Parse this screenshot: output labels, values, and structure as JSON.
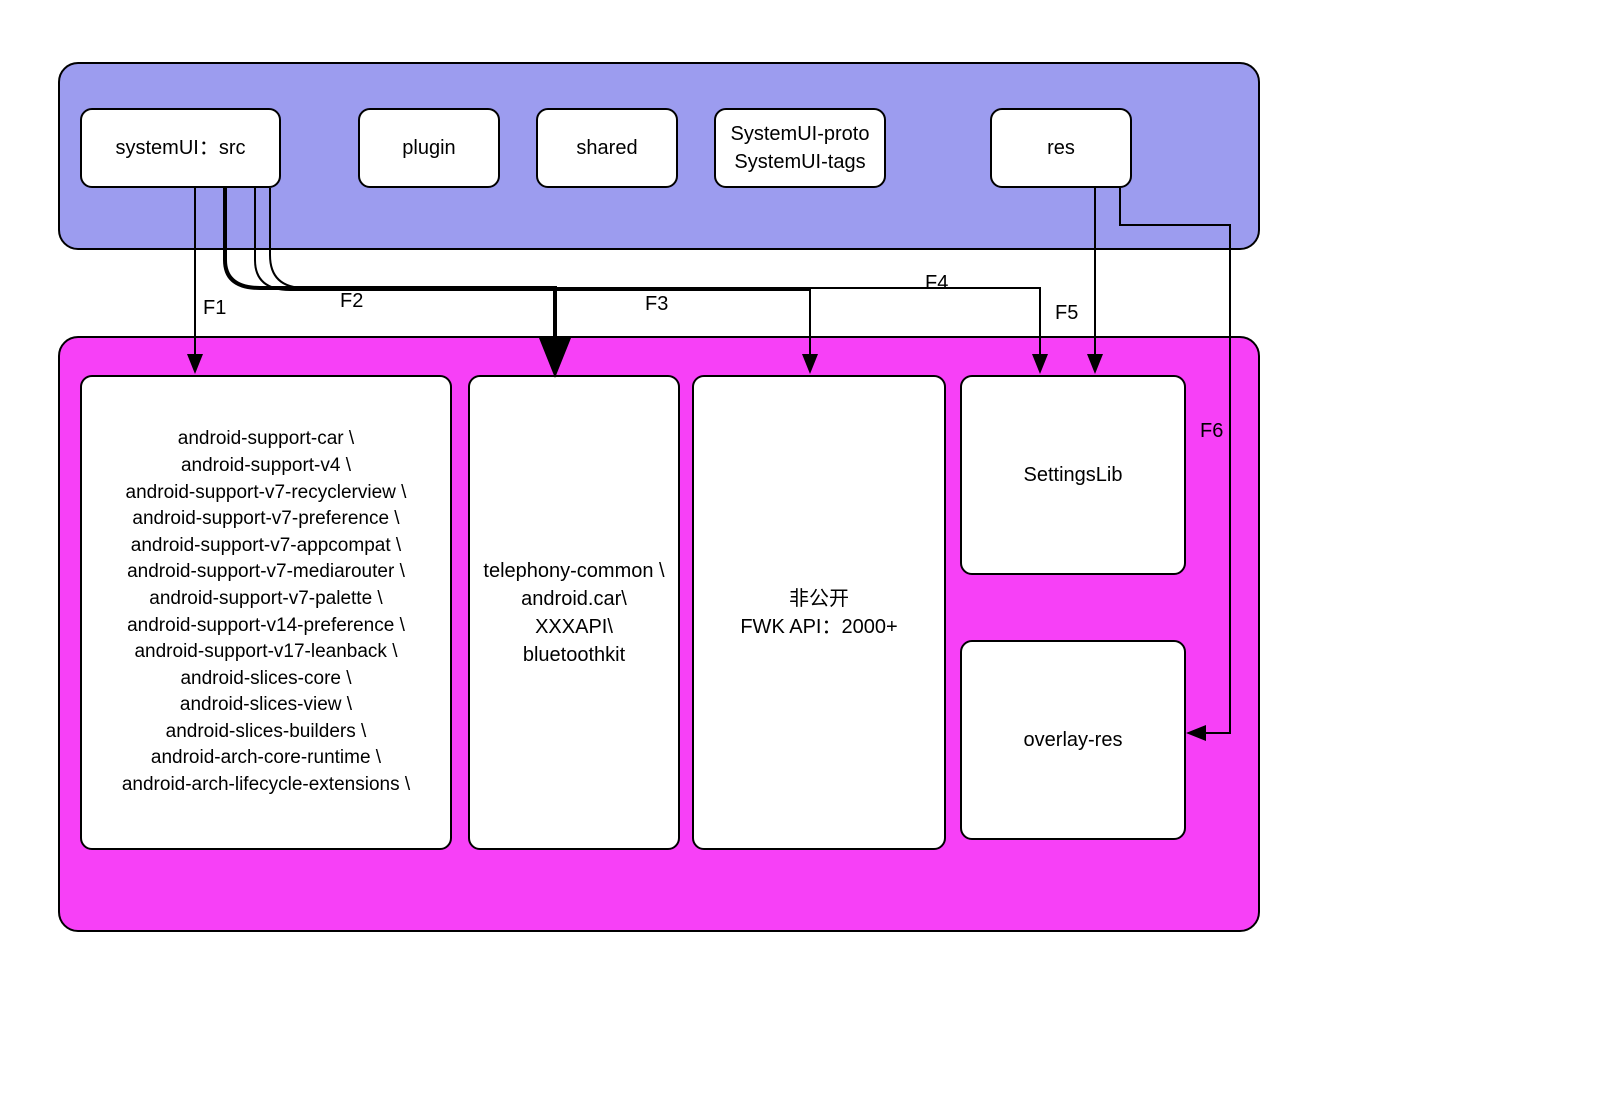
{
  "top": {
    "systemui_src": "systemUI：src",
    "plugin": "plugin",
    "shared": "shared",
    "proto_tags_line1": "SystemUI-proto",
    "proto_tags_line2": "SystemUI-tags",
    "res": "res"
  },
  "bottom": {
    "support_libs": [
      "android-support-car \\",
      "android-support-v4 \\",
      "android-support-v7-recyclerview \\",
      "android-support-v7-preference \\",
      "android-support-v7-appcompat \\",
      "android-support-v7-mediarouter \\",
      "android-support-v7-palette \\",
      "android-support-v14-preference \\",
      "android-support-v17-leanback \\",
      "android-slices-core \\",
      "android-slices-view \\",
      "android-slices-builders \\",
      "android-arch-core-runtime \\",
      "android-arch-lifecycle-extensions \\"
    ],
    "telephony": [
      "telephony-common \\",
      "android.car\\",
      "XXXAPI\\",
      "bluetoothkit"
    ],
    "fwk_line1": "非公开",
    "fwk_line2": "FWK API：2000+",
    "settingslib": "SettingsLib",
    "overlay_res": "overlay-res"
  },
  "edges": {
    "f1": "F1",
    "f2": "F2",
    "f3": "F3",
    "f4": "F4",
    "f5": "F5",
    "f6": "F6"
  }
}
